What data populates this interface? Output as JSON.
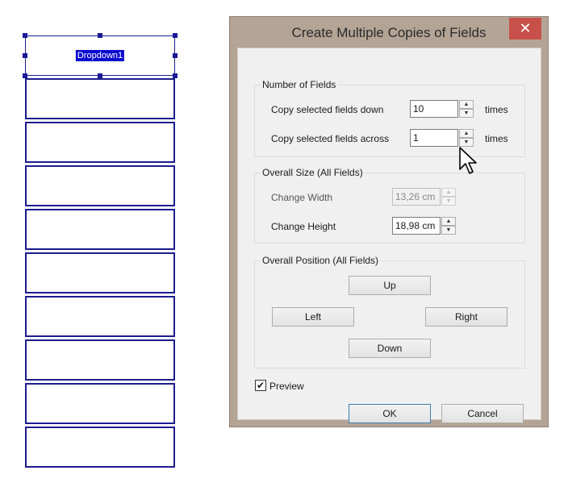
{
  "canvas": {
    "selected_field_label": "Dropdown1",
    "field_count": 10
  },
  "dialog": {
    "title": "Create Multiple Copies of Fields",
    "close_glyph": "✕",
    "number_of_fields": {
      "legend": "Number of Fields",
      "down_label": "Copy selected fields down",
      "down_value": "10",
      "down_suffix": "times",
      "across_label": "Copy selected fields across",
      "across_value": "1",
      "across_suffix": "times"
    },
    "overall_size": {
      "legend": "Overall Size (All Fields)",
      "width_label": "Change Width",
      "width_value": "13,26 cm",
      "height_label": "Change Height",
      "height_value": "18,98 cm"
    },
    "overall_position": {
      "legend": "Overall Position (All Fields)",
      "up": "Up",
      "left": "Left",
      "right": "Right",
      "down": "Down"
    },
    "preview_label": "Preview",
    "preview_checked": true,
    "ok": "OK",
    "cancel": "Cancel"
  },
  "icons": {
    "spin_up": "▲",
    "spin_down": "▼",
    "checkmark": "✔"
  },
  "colors": {
    "field_border": "#1c1c8f",
    "selection_highlight": "#0a0ad0",
    "close_button": "#c7504a",
    "dialog_frame": "#b4a495"
  }
}
